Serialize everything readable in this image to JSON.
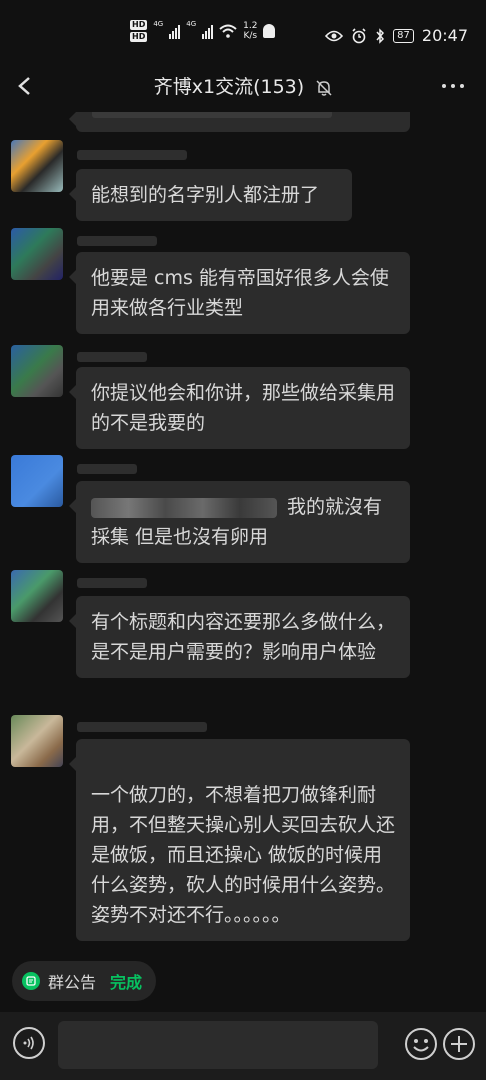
{
  "statusbar": {
    "hd_label": "HD",
    "net_label": "4G",
    "speed_value": "1.2",
    "speed_unit": "K/s",
    "battery": "87",
    "time": "20:47"
  },
  "header": {
    "title": "齐博x1交流(153)",
    "back_icon": "back-arrow-icon",
    "mute_icon": "bell-mute-icon",
    "more_icon": "more-icon"
  },
  "messages": [
    {
      "text": "能想到的名字别人都注册了"
    },
    {
      "text": "他要是 cms 能有帝国好很多人会使用来做各行业类型"
    },
    {
      "text": "你提议他会和你讲，那些做给采集用的不是我要的"
    },
    {
      "text": "我的就沒有採集 但是也沒有卵用"
    },
    {
      "text": "有个标题和内容还要那么多做什么，是不是用户需要的？影响用户体验"
    },
    {
      "text": "一个做刀的，不想着把刀做锋利耐用，不但整天操心别人买回去砍人还是做饭，而且还操心 做饭的时候用什么姿势，砍人的时候用什么姿势。\n姿势不对还不行。。。。。。"
    }
  ],
  "notice": {
    "label": "群公告",
    "status": "完成",
    "accent": "#07c160"
  },
  "input": {
    "placeholder": "",
    "voice_icon": "voice-icon",
    "emoji_icon": "emoji-icon",
    "plus_icon": "plus-icon"
  }
}
